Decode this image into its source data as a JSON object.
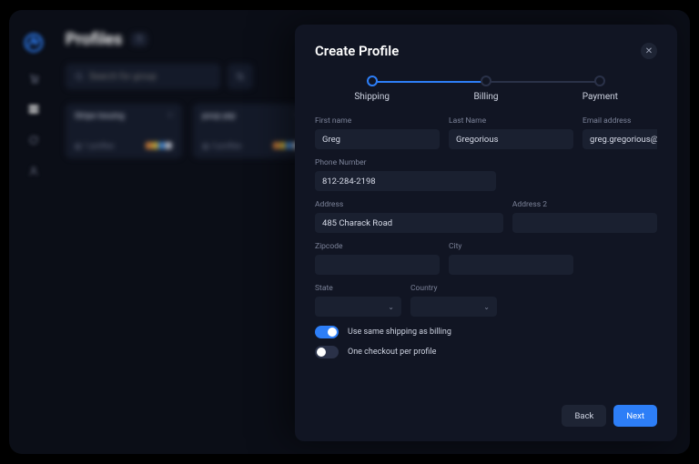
{
  "page": {
    "title": "Profiles",
    "count": "1"
  },
  "search": {
    "placeholder": "Search for group"
  },
  "cards": [
    {
      "name": "Stripe Issuing",
      "count": "1 profiles"
    },
    {
      "name": "poop yep",
      "count": "3 profiles"
    }
  ],
  "modal": {
    "title": "Create Profile",
    "steps": [
      "Shipping",
      "Billing",
      "Payment"
    ],
    "labels": {
      "first_name": "First name",
      "last_name": "Last Name",
      "email": "Email address",
      "phone": "Phone Number",
      "address": "Address",
      "address2": "Address 2",
      "zipcode": "Zipcode",
      "city": "City",
      "state": "State",
      "country": "Country"
    },
    "values": {
      "first_name": "Greg",
      "last_name": "Gregorious",
      "email": "greg.gregorious@gregger.com",
      "phone": "812-284-2198",
      "address": "485 Charack Road",
      "address2": "",
      "zipcode": "",
      "city": "",
      "state": "",
      "country": ""
    },
    "toggles": {
      "same_shipping": {
        "label": "Use same shipping as billing",
        "on": true
      },
      "one_checkout": {
        "label": "One checkout per profile",
        "on": false
      }
    },
    "buttons": {
      "back": "Back",
      "next": "Next"
    }
  },
  "avatar_colors": [
    "#e68a3c",
    "#e6c33c",
    "#3c8fe6",
    "#c9cdd8"
  ]
}
